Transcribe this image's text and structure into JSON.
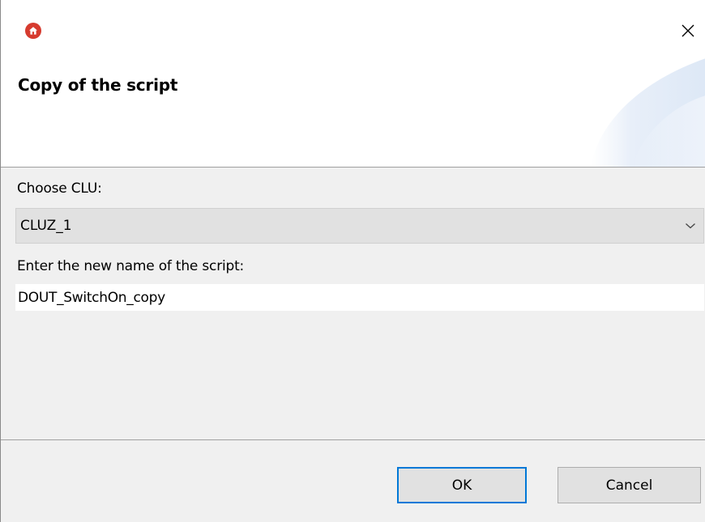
{
  "window": {
    "title": "Copy of the script",
    "app_icon": "home-icon",
    "close_icon": "close-icon",
    "accent_color": "#d63b2f"
  },
  "form": {
    "clu_label": "Choose CLU:",
    "clu_selected": "CLUZ_1",
    "clu_dropdown_icon": "chevron-down-icon",
    "name_label": "Enter the new name of the script:",
    "name_value": "DOUT_SwitchOn_copy"
  },
  "buttons": {
    "ok_label": "OK",
    "cancel_label": "Cancel",
    "focus_color": "#0078d7"
  }
}
